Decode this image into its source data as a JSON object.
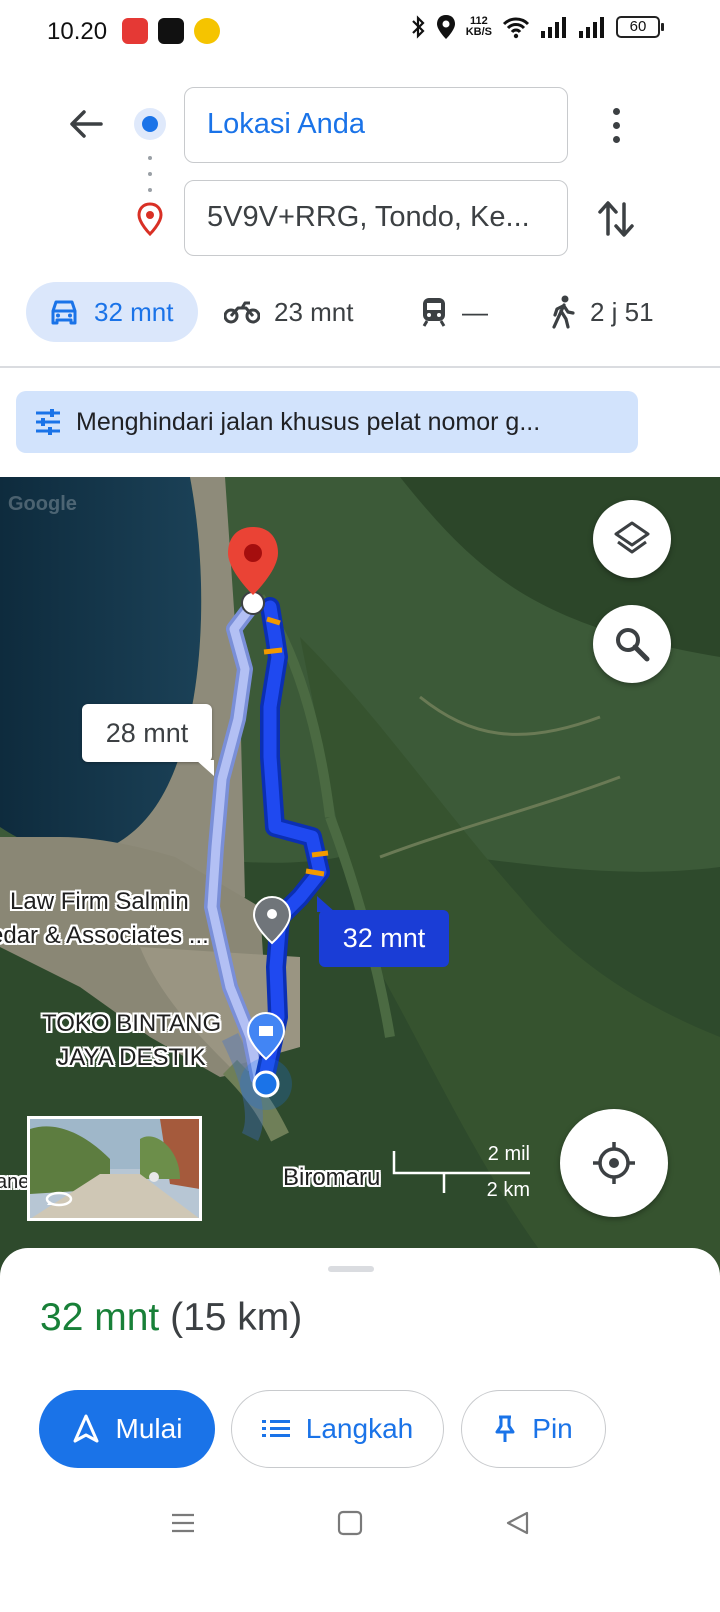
{
  "status_bar": {
    "time": "10.20",
    "net_speed_value": "112",
    "net_speed_unit": "KB/S",
    "battery": "60",
    "icons": [
      "app-notification-icon",
      "chat-app-icon",
      "ride-app-icon",
      "bluetooth-icon",
      "location-icon",
      "wifi-icon",
      "signal-icon",
      "signal-icon",
      "battery-icon"
    ]
  },
  "route": {
    "origin": "Lokasi Anda",
    "destination": "5V9V+RRG, Tondo, Ke..."
  },
  "modes": [
    {
      "name": "car",
      "label": "32 mnt",
      "selected": true
    },
    {
      "name": "motorcycle",
      "label": "23 mnt",
      "selected": false
    },
    {
      "name": "transit",
      "label": "—",
      "selected": false
    },
    {
      "name": "walk",
      "label": "2 j 51",
      "selected": false
    }
  ],
  "notice": "Menghindari jalan khusus pelat nomor g...",
  "map": {
    "watermark": "Google",
    "alt_route_time": "28 mnt",
    "main_route_time": "32 mnt",
    "place_lawfirm": "Law Firm Salmin\nedar & Associates ...",
    "place_toko": "TOKO BINTANG\nJAYA DESTIK",
    "place_biromaru": "Biromaru",
    "place_edge": "ane",
    "scale_mi": "2 mil",
    "scale_km": "2 km",
    "colors": {
      "route": "#1a3dd6",
      "alt_route": "#a9b8f5",
      "traffic": "#f29900",
      "pin": "#ea4335"
    }
  },
  "summary": {
    "time": "32 mnt",
    "distance": "(15 km)"
  },
  "actions": {
    "start": "Mulai",
    "steps": "Langkah",
    "pin": "Pin"
  },
  "colors": {
    "accent": "#1a73e8",
    "time_green": "#188038",
    "chip_bg": "#dbe7fb"
  }
}
